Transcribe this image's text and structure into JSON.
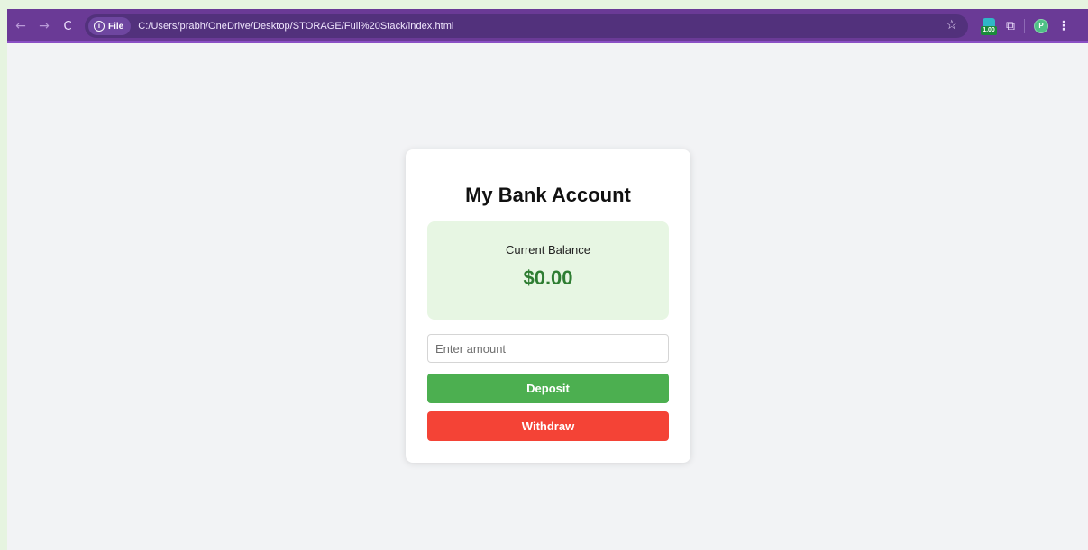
{
  "browser": {
    "nav": {
      "back_glyph": "←",
      "forward_glyph": "→",
      "reload_glyph": "C"
    },
    "site_chip": {
      "info_glyph": "i",
      "label": "File"
    },
    "url": "C:/Users/prabh/OneDrive/Desktop/STORAGE/Full%20Stack/index.html",
    "bookmark_glyph": "☆",
    "extension_badge_value": "1.00",
    "profile_initial": "P",
    "menu_glyph": "⋮",
    "icons": [
      "back-arrow-icon",
      "forward-arrow-icon",
      "reload-icon",
      "info-icon",
      "star-icon",
      "extension-icon",
      "puzzle-icon",
      "profile-avatar",
      "kebab-menu-icon"
    ],
    "colors": {
      "toolbar": "#6a3a96",
      "omnibox": "#52317c"
    }
  },
  "app": {
    "title": "My Bank Account",
    "balance": {
      "label": "Current Balance",
      "value": "$0.00"
    },
    "amount_input": {
      "value": "",
      "placeholder": "Enter amount"
    },
    "deposit_label": "Deposit",
    "withdraw_label": "Withdraw",
    "colors": {
      "page_background": "#f2f3f5",
      "balance_background": "#e7f6e3",
      "balance_text": "#2e7d32",
      "deposit": "#4caf50",
      "withdraw": "#f44336"
    }
  }
}
